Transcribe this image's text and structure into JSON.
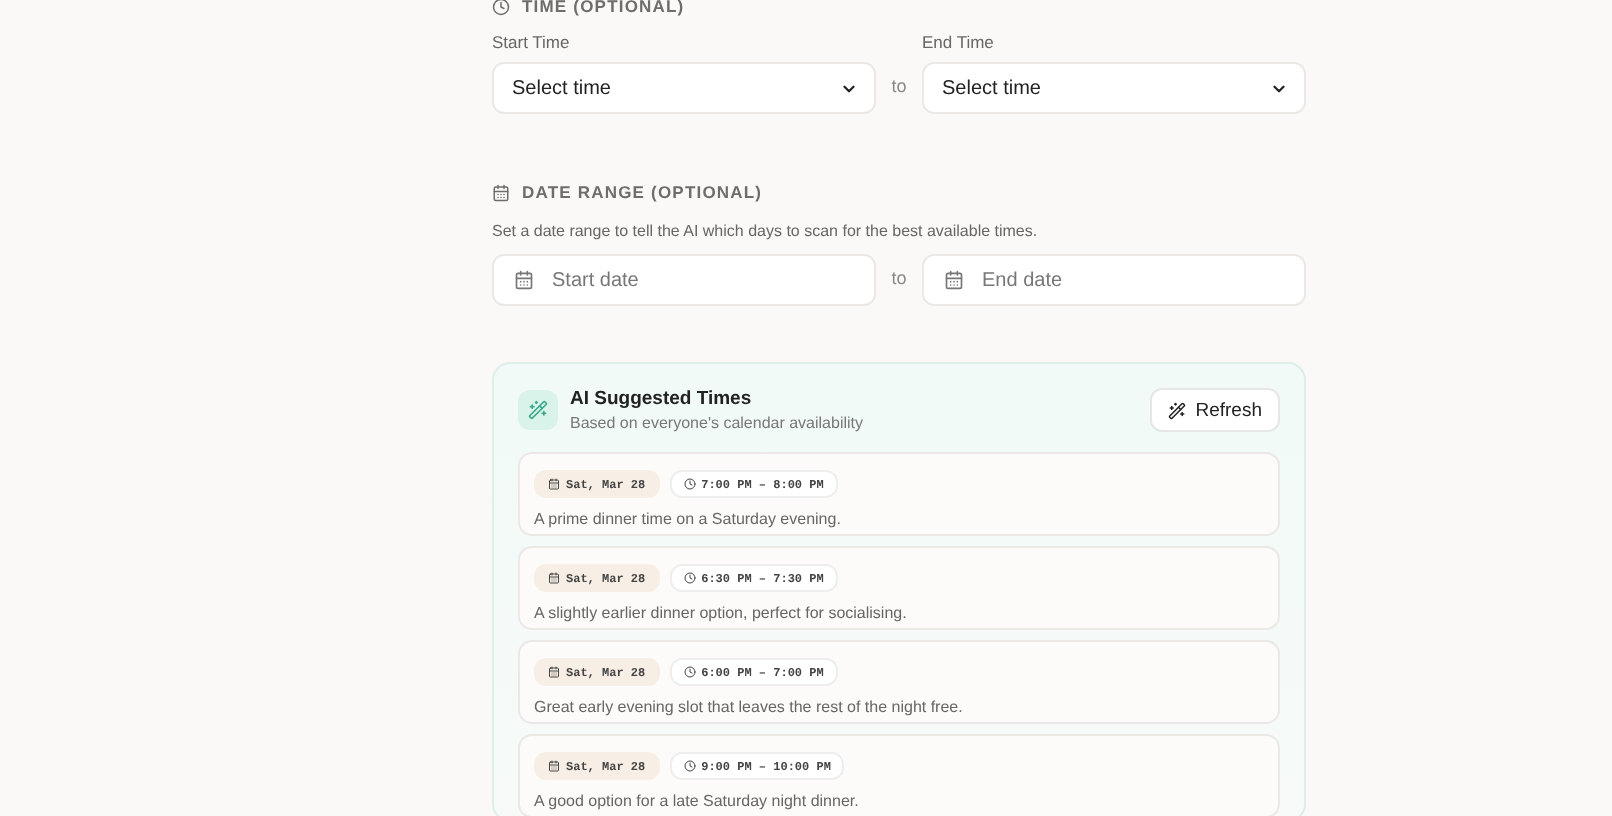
{
  "time_section": {
    "heading": "TIME (OPTIONAL)",
    "start": {
      "label": "Start Time",
      "value": "Select time"
    },
    "separator": "to",
    "end": {
      "label": "End Time",
      "value": "Select time"
    }
  },
  "date_section": {
    "heading": "DATE RANGE (OPTIONAL)",
    "description": "Set a date range to tell the AI which days to scan for the best available times.",
    "start": {
      "placeholder": "Start date"
    },
    "separator": "to",
    "end": {
      "placeholder": "End date"
    }
  },
  "suggestions": {
    "title": "AI Suggested Times",
    "subtitle": "Based on everyone's calendar availability",
    "refresh_button": "Refresh",
    "items": [
      {
        "date": "Sat, Mar 28",
        "time": "7:00 PM – 8:00 PM",
        "note": "A prime dinner time on a Saturday evening."
      },
      {
        "date": "Sat, Mar 28",
        "time": "6:30 PM – 7:30 PM",
        "note": "A slightly earlier dinner option, perfect for socialising."
      },
      {
        "date": "Sat, Mar 28",
        "time": "6:00 PM – 7:00 PM",
        "note": "Great early evening slot that leaves the rest of the night free."
      },
      {
        "date": "Sat, Mar 28",
        "time": "9:00 PM – 10:00 PM",
        "note": "A good option for a late Saturday night dinner."
      }
    ]
  }
}
